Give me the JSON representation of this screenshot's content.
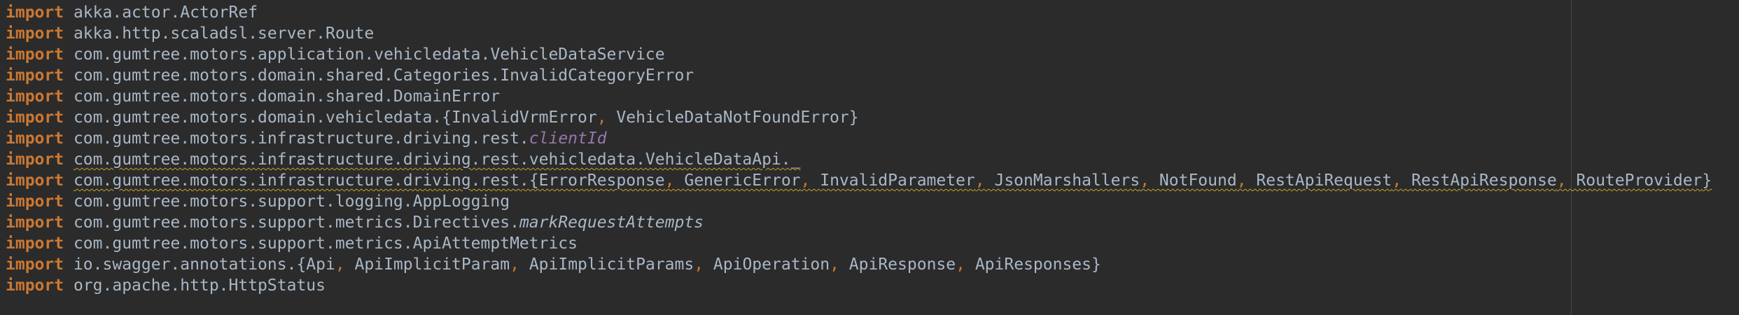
{
  "editor": {
    "keyword": "import",
    "colors": {
      "background": "#2b2b2b",
      "keyword": "#cc7832",
      "text": "#a9b7c6",
      "member": "#9876aa",
      "warning_underline": "#c8a228"
    },
    "lines": [
      {
        "path": "akka.actor.ActorRef"
      },
      {
        "path": "akka.http.scaladsl.server.Route"
      },
      {
        "path": "com.gumtree.motors.application.vehicledata.VehicleDataService"
      },
      {
        "path": "com.gumtree.motors.domain.shared.Categories.InvalidCategoryError"
      },
      {
        "path": "com.gumtree.motors.domain.shared.DomainError"
      },
      {
        "prefix": "com.gumtree.motors.domain.vehicledata.{",
        "items": [
          "InvalidVrmError",
          "VehicleDataNotFoundError"
        ],
        "separator": ", ",
        "suffix": "}"
      },
      {
        "prefix": "com.gumtree.motors.infrastructure.driving.rest.",
        "member": "clientId"
      },
      {
        "path": "com.gumtree.motors.infrastructure.driving.rest.vehicledata.VehicleDataApi._",
        "unused": true
      },
      {
        "prefix": "com.gumtree.motors.infrastructure.driving.rest.{",
        "items": [
          "ErrorResponse",
          "GenericError",
          "InvalidParameter",
          "JsonMarshallers",
          "NotFound",
          "RestApiRequest",
          "RestApiResponse",
          "RouteProvider"
        ],
        "separator": ", ",
        "suffix": "}",
        "unused": true
      },
      {
        "path": "com.gumtree.motors.support.logging.AppLogging"
      },
      {
        "prefix": "com.gumtree.motors.support.metrics.Directives.",
        "member_italic": "markRequestAttempts"
      },
      {
        "path": "com.gumtree.motors.support.metrics.ApiAttemptMetrics"
      },
      {
        "prefix": "io.swagger.annotations.{",
        "items": [
          "Api",
          "ApiImplicitParam",
          "ApiImplicitParams",
          "ApiOperation",
          "ApiResponse",
          "ApiResponses"
        ],
        "separator": ", ",
        "suffix": "}"
      },
      {
        "path": "org.apache.http.HttpStatus"
      }
    ]
  }
}
